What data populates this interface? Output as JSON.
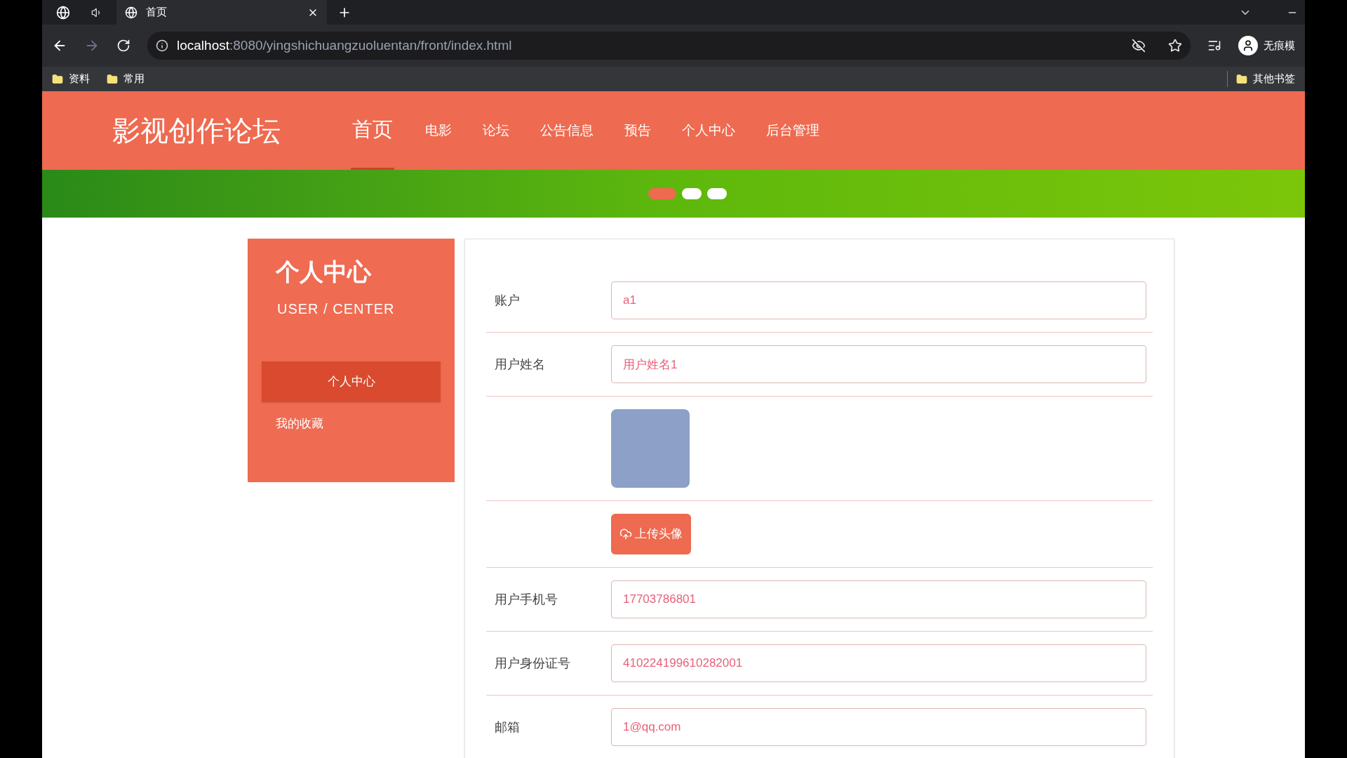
{
  "browser": {
    "tab": {
      "title": "首页"
    },
    "url": {
      "host": "localhost",
      "rest": ":8080/yingshichuangzuoluentan/front/index.html"
    },
    "profile": "无痕模",
    "bookmarks": [
      "资料",
      "常用"
    ],
    "other_bookmarks": "其他书签"
  },
  "site": {
    "logo": "影视创作论坛",
    "nav": [
      {
        "label": "首页",
        "selected": true
      },
      {
        "label": "电影",
        "selected": false
      },
      {
        "label": "论坛",
        "selected": false
      },
      {
        "label": "公告信息",
        "selected": false
      },
      {
        "label": "预告",
        "selected": false
      },
      {
        "label": "个人中心",
        "selected": false
      },
      {
        "label": "后台管理",
        "selected": false
      }
    ]
  },
  "carousel": {
    "dots": [
      {
        "selected": true
      },
      {
        "selected": false
      },
      {
        "selected": false
      }
    ]
  },
  "sidebar": {
    "title": "个人中心",
    "subtitle": "USER / CENTER",
    "items": [
      {
        "label": "个人中心",
        "selected": true
      },
      {
        "label": "我的收藏",
        "selected": false
      }
    ]
  },
  "form": {
    "rows": [
      {
        "kind": "input",
        "label": "账户",
        "value": "a1"
      },
      {
        "kind": "input",
        "label": "用户姓名",
        "value": "用户姓名1"
      },
      {
        "kind": "avatar"
      },
      {
        "kind": "upload",
        "button": "上传头像"
      },
      {
        "kind": "input",
        "label": "用户手机号",
        "value": "17703786801"
      },
      {
        "kind": "input",
        "label": "用户身份证号",
        "value": "410224199610282001"
      },
      {
        "kind": "input",
        "label": "邮箱",
        "value": "1@qq.com"
      }
    ]
  }
}
